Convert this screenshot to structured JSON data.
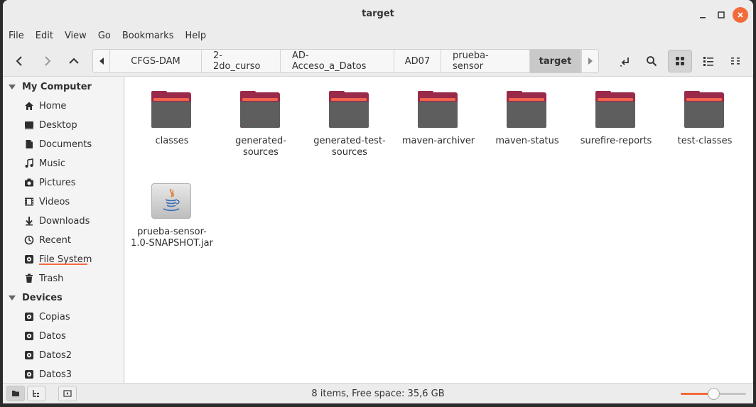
{
  "window": {
    "title": "target"
  },
  "menu": [
    "File",
    "Edit",
    "View",
    "Go",
    "Bookmarks",
    "Help"
  ],
  "breadcrumbs": [
    "CFGS-DAM",
    "2-2do_curso",
    "AD-Acceso_a_Datos",
    "AD07",
    "prueba-sensor",
    "target"
  ],
  "sidebar": {
    "sections": [
      {
        "header": "My Computer",
        "items": [
          "Home",
          "Desktop",
          "Documents",
          "Music",
          "Pictures",
          "Videos",
          "Downloads",
          "Recent",
          "File System",
          "Trash"
        ]
      },
      {
        "header": "Devices",
        "items": [
          "Copias",
          "Datos",
          "Datos2",
          "Datos3"
        ]
      }
    ]
  },
  "files": [
    {
      "name": "classes",
      "type": "folder"
    },
    {
      "name": "generated-sources",
      "type": "folder"
    },
    {
      "name": "generated-test-sources",
      "type": "folder"
    },
    {
      "name": "maven-archiver",
      "type": "folder"
    },
    {
      "name": "maven-status",
      "type": "folder"
    },
    {
      "name": "surefire-reports",
      "type": "folder"
    },
    {
      "name": "test-classes",
      "type": "folder"
    },
    {
      "name": "prueba-sensor-1.0-SNAPSHOT.jar",
      "type": "jar"
    }
  ],
  "status": {
    "text": "8 items, Free space: 35,6 GB",
    "zoom_fraction": 0.5
  },
  "colors": {
    "accent": "#f26b3a",
    "folder_top": "#9a2a4a",
    "folder_body": "#5e5e5e",
    "folder_stripe": "#f3634d"
  }
}
